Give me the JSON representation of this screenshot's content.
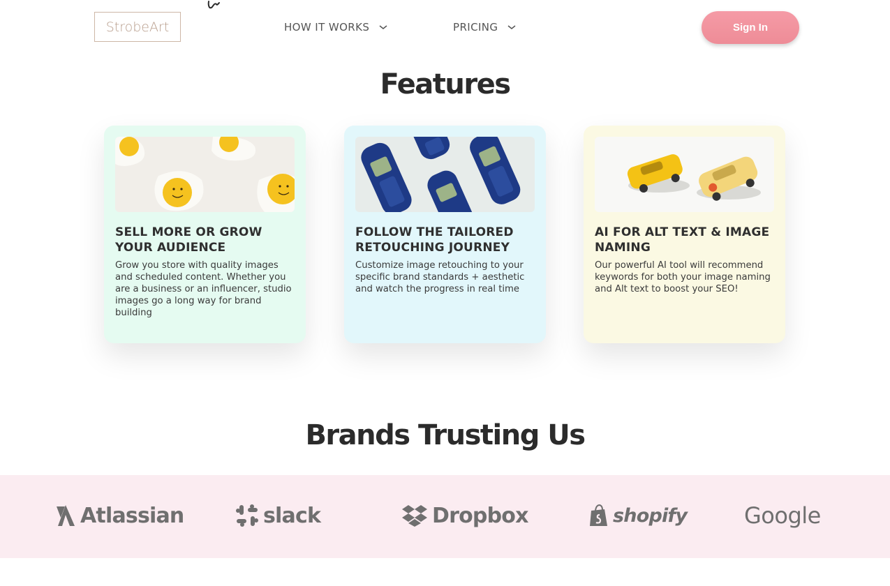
{
  "header": {
    "logo_text": "StrobeArt",
    "nav": [
      {
        "label": "HOW IT WORKS",
        "icon": "chevron-down-icon"
      },
      {
        "label": "PRICING",
        "icon": "chevron-down-icon"
      }
    ],
    "signin_label": "Sign In",
    "colors": {
      "signin": "#ee8c97",
      "logo": "#b99f8e"
    }
  },
  "features": {
    "title": "Features",
    "cards": [
      {
        "title": "SELL MORE OR GROW YOUR AUDIENCE",
        "description": "Grow you store with quality images and scheduled content. Whether you are a business or an influencer, studio images go a long way for brand building",
        "image": "fried-eggs-smiley-photo",
        "background": "#e5fbf1"
      },
      {
        "title": "FOLLOW THE TAILORED RETOUCHING JOURNEY",
        "description": "Customize image retouching to your specific brand standards + aesthetic and watch the progress in real time",
        "image": "blue-mobile-phones-photo",
        "background": "#e2f7fb"
      },
      {
        "title": "AI FOR ALT TEXT & IMAGE NAMING",
        "description": "Our powerful AI tool will recommend keywords for both your image naming and Alt text to boost your SEO!",
        "image": "toy-cars-photo",
        "background": "#fbf9e3"
      }
    ]
  },
  "brands": {
    "title": "Brands Trusting Us",
    "background": "#fbecf1",
    "logos": [
      {
        "name": "Atlassian",
        "icon": "atlassian-logo-icon"
      },
      {
        "name": "slack",
        "icon": "slack-logo-icon"
      },
      {
        "name": "Dropbox",
        "icon": "dropbox-logo-icon"
      },
      {
        "name": "shopify",
        "icon": "shopify-bag-icon"
      },
      {
        "name": "Google",
        "icon": "google-logo-icon"
      }
    ]
  }
}
